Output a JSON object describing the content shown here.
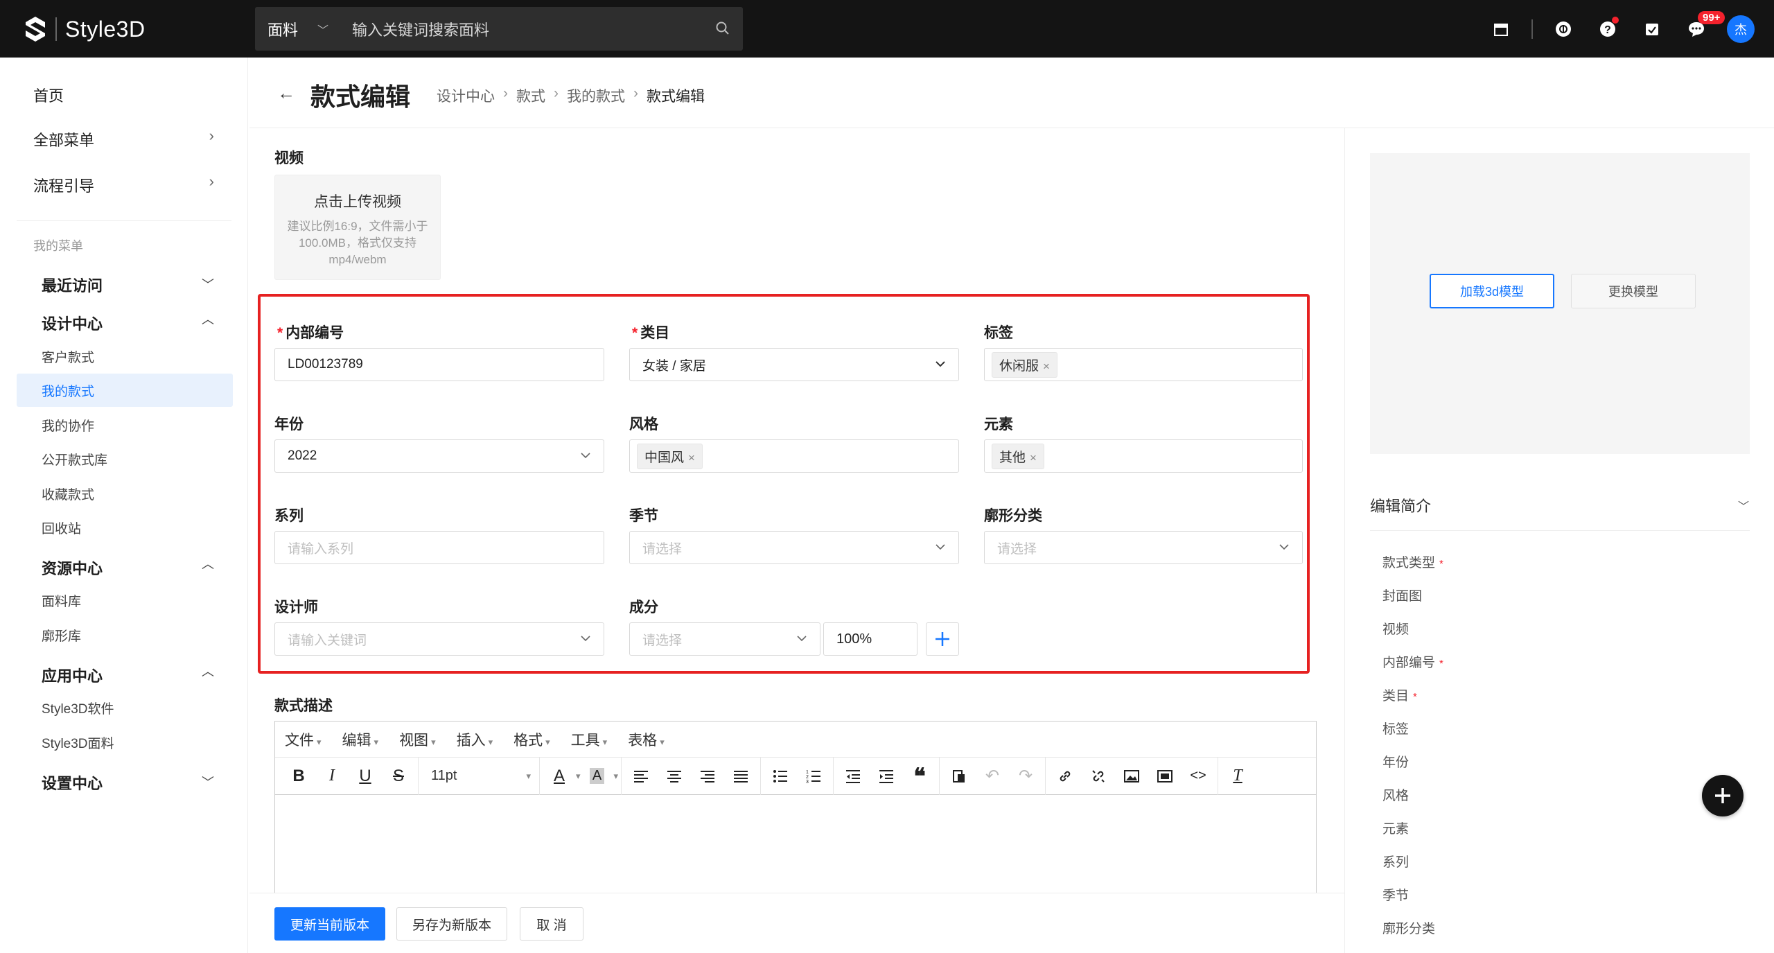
{
  "app": {
    "name": "Style3D"
  },
  "search": {
    "type": "面料",
    "placeholder": "输入关键词搜索面料"
  },
  "topbar": {
    "message_badge": "99+",
    "avatar_initial": "杰"
  },
  "sidebar": {
    "home": "首页",
    "all_menu": "全部菜单",
    "process_guide": "流程引导",
    "my_menu": "我的菜单",
    "groups": [
      {
        "label": "最近访问",
        "items": []
      },
      {
        "label": "设计中心",
        "items": [
          "客户款式",
          "我的款式",
          "我的协作",
          "公开款式库",
          "收藏款式",
          "回收站"
        ]
      },
      {
        "label": "资源中心",
        "items": [
          "面料库",
          "廓形库"
        ]
      },
      {
        "label": "应用中心",
        "items": [
          "Style3D软件",
          "Style3D面料"
        ]
      },
      {
        "label": "设置中心",
        "items": []
      }
    ]
  },
  "page": {
    "title": "款式编辑",
    "breadcrumb": [
      "设计中心",
      "款式",
      "我的款式",
      "款式编辑"
    ]
  },
  "video": {
    "label": "视频",
    "upload_title": "点击上传视频",
    "upload_hint": "建议比例16:9，文件需小于100.0MB，格式仅支持mp4/webm"
  },
  "form": {
    "internal_no": {
      "label": "内部编号",
      "value": "LD00123789"
    },
    "category": {
      "label": "类目",
      "value": "女装 / 家居"
    },
    "tags": {
      "label": "标签",
      "value": "休闲服"
    },
    "year": {
      "label": "年份",
      "value": "2022"
    },
    "style": {
      "label": "风格",
      "value": "中国风"
    },
    "element": {
      "label": "元素",
      "value": "其他"
    },
    "series": {
      "label": "系列",
      "placeholder": "请输入系列"
    },
    "season": {
      "label": "季节",
      "placeholder": "请选择"
    },
    "silhouette": {
      "label": "廓形分类",
      "placeholder": "请选择"
    },
    "designer": {
      "label": "设计师",
      "placeholder": "请输入关键词"
    },
    "composition": {
      "label": "成分",
      "placeholder": "请选择",
      "percent": "100%"
    }
  },
  "description": {
    "label": "款式描述",
    "menus": [
      "文件",
      "编辑",
      "视图",
      "插入",
      "格式",
      "工具",
      "表格"
    ],
    "font_size": "11pt"
  },
  "footer": {
    "update": "更新当前版本",
    "save_new": "另存为新版本",
    "cancel": "取 消"
  },
  "right_panel": {
    "load_model": "加载3d模型",
    "change_model": "更换模型",
    "intro_title": "编辑简介",
    "intro_items": [
      {
        "label": "款式类型",
        "required": true
      },
      {
        "label": "封面图",
        "required": false
      },
      {
        "label": "视频",
        "required": false
      },
      {
        "label": "内部编号",
        "required": true
      },
      {
        "label": "类目",
        "required": true
      },
      {
        "label": "标签",
        "required": false
      },
      {
        "label": "年份",
        "required": false
      },
      {
        "label": "风格",
        "required": false
      },
      {
        "label": "元素",
        "required": false
      },
      {
        "label": "系列",
        "required": false
      },
      {
        "label": "季节",
        "required": false
      },
      {
        "label": "廓形分类",
        "required": false
      }
    ]
  },
  "colors": {
    "primary": "#1677ff",
    "highlight_box": "#e62121",
    "topbar": "#141414"
  }
}
